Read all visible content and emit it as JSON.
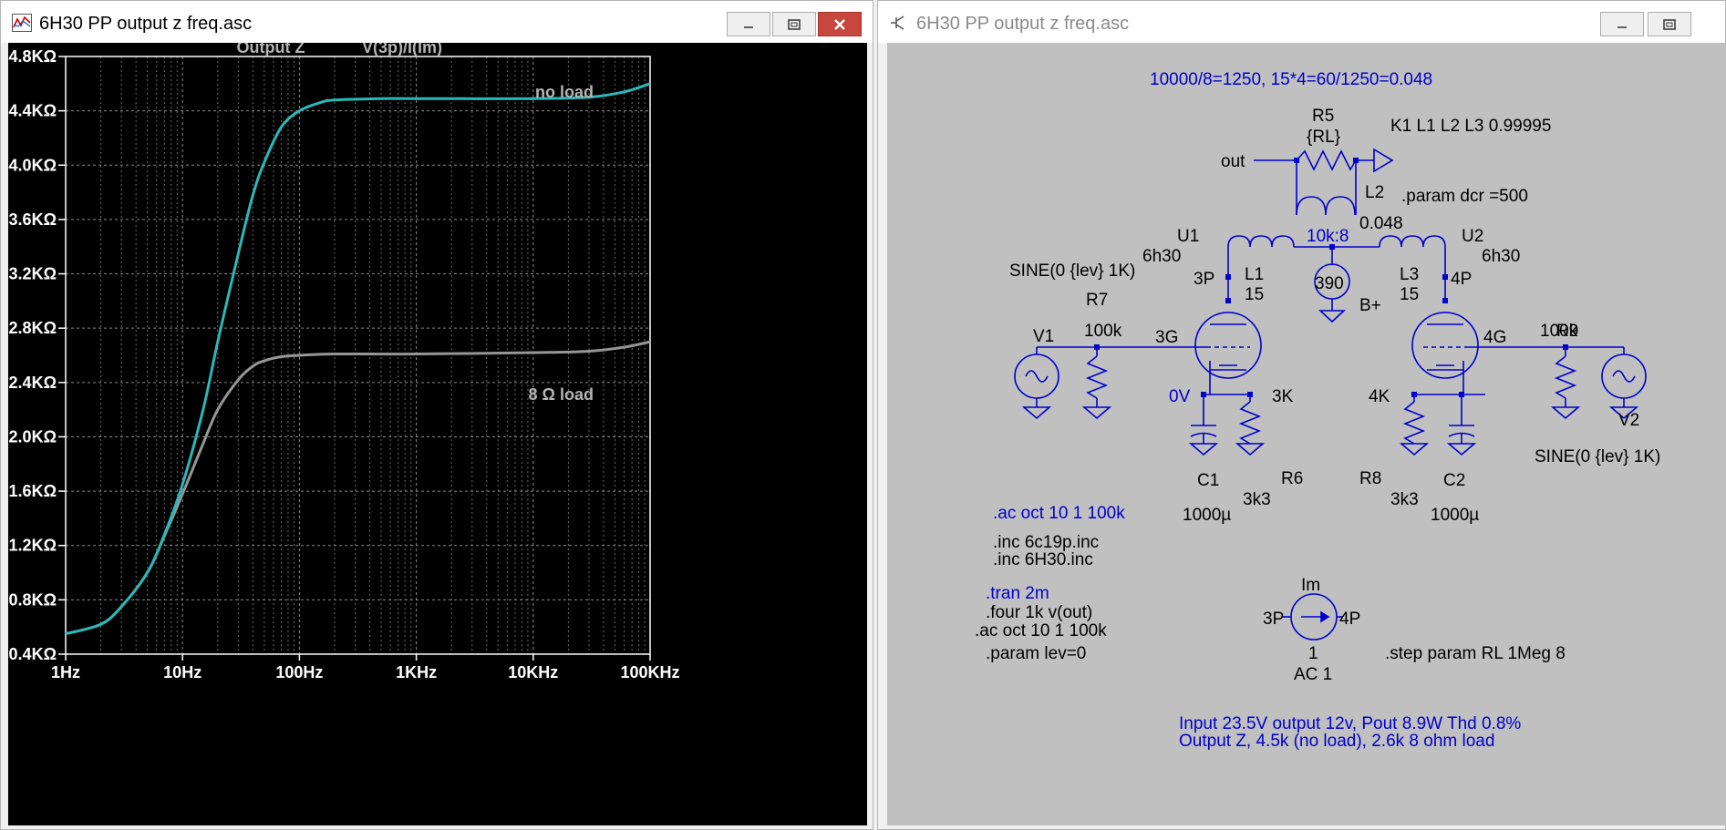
{
  "left_window": {
    "title": "6H30 PP output z freq.asc",
    "controls": [
      "minimize-icon",
      "maximize-icon",
      "close-icon"
    ]
  },
  "right_window": {
    "title": "6H30 PP output z freq.asc",
    "controls": [
      "minimize-icon",
      "maximize-icon"
    ]
  },
  "chart_data": {
    "type": "line",
    "title": "Output Z",
    "subtitle": "V(3p)/I(Im)",
    "xscale": "log",
    "xlim": [
      1,
      100000
    ],
    "ylim": [
      0.4,
      4.8
    ],
    "x_tick_values": [
      1,
      10,
      100,
      1000,
      10000,
      100000
    ],
    "x_tick_labels": [
      "1Hz",
      "10Hz",
      "100Hz",
      "1KHz",
      "10KHz",
      "100KHz"
    ],
    "y_tick_values": [
      0.4,
      0.8,
      1.2,
      1.6,
      2.0,
      2.4,
      2.8,
      3.2,
      3.6,
      4.0,
      4.4,
      4.8
    ],
    "y_tick_labels": [
      "0.4KΩ",
      "0.8KΩ",
      "1.2KΩ",
      "1.6KΩ",
      "2.0KΩ",
      "2.4KΩ",
      "2.8KΩ",
      "3.2KΩ",
      "3.6KΩ",
      "4.0KΩ",
      "4.4KΩ",
      "4.8KΩ"
    ],
    "grid": true,
    "background": "#000000",
    "series": [
      {
        "name": "no load",
        "color": "#2bb8b8",
        "points": [
          [
            1,
            0.55
          ],
          [
            2,
            0.62
          ],
          [
            3,
            0.75
          ],
          [
            5,
            1.0
          ],
          [
            7,
            1.28
          ],
          [
            10,
            1.65
          ],
          [
            15,
            2.2
          ],
          [
            20,
            2.7
          ],
          [
            30,
            3.35
          ],
          [
            40,
            3.78
          ],
          [
            50,
            4.02
          ],
          [
            70,
            4.28
          ],
          [
            100,
            4.4
          ],
          [
            150,
            4.46
          ],
          [
            200,
            4.48
          ],
          [
            500,
            4.49
          ],
          [
            1000,
            4.49
          ],
          [
            10000,
            4.49
          ],
          [
            30000,
            4.5
          ],
          [
            60000,
            4.54
          ],
          [
            100000,
            4.6
          ]
        ]
      },
      {
        "name": "8 Ω load",
        "color": "#969696",
        "points": [
          [
            1,
            0.55
          ],
          [
            2,
            0.62
          ],
          [
            3,
            0.75
          ],
          [
            5,
            1.0
          ],
          [
            7,
            1.27
          ],
          [
            10,
            1.58
          ],
          [
            15,
            1.95
          ],
          [
            20,
            2.2
          ],
          [
            30,
            2.42
          ],
          [
            40,
            2.52
          ],
          [
            50,
            2.56
          ],
          [
            70,
            2.59
          ],
          [
            100,
            2.6
          ],
          [
            200,
            2.61
          ],
          [
            1000,
            2.61
          ],
          [
            10000,
            2.62
          ],
          [
            30000,
            2.63
          ],
          [
            60000,
            2.66
          ],
          [
            100000,
            2.7
          ]
        ]
      }
    ]
  },
  "schematic": {
    "notes": {
      "ratio_note": "10000/8=1250, 15*4=60/1250=0.048",
      "coupling": "K1 L1 L2 L3 0.99995",
      "param_dcr": ".param dcr =500",
      "ac_blue": ".ac oct 10 1 100k",
      "inc1": ".inc 6c19p.inc",
      "inc2": ".inc 6H30.inc",
      "tran": ".tran 2m",
      "four": ".four 1k v(out)",
      "ac2": ".ac oct 10 1 100k",
      "param_lev": ".param lev=0",
      "step": ".step param RL 1Meg 8",
      "result1": "Input 23.5V output 12v, Pout 8.9W Thd 0.8%",
      "result2": "Output Z, 4.5k (no load), 2.6k 8 ohm load"
    },
    "labels": {
      "r5": "R5",
      "r5_val": "{RL}",
      "out": "out",
      "l2": "L2",
      "l2_val": "0.048",
      "ratio": "10k:8",
      "u1": "U1",
      "u1_model": "6h30",
      "u2": "U2",
      "u2_model": "6h30",
      "l1": "L1",
      "l1_val": "15",
      "l3": "L3",
      "l3_val": "15",
      "n3p": "3P",
      "n4p": "4P",
      "bplus_val": "390",
      "bplus": "B+",
      "sine1": "SINE(0 {lev} 1K)",
      "sine2": "SINE(0 {lev} 1K)",
      "r7": "R7",
      "r7_val": "100k",
      "r9": "R9",
      "r9_val": "100k",
      "v1": "V1",
      "v2": "V2",
      "n3g": "3G",
      "n4g": "4G",
      "n0v": "0V",
      "n3k": "3K",
      "n4k": "4K",
      "c1": "C1",
      "c1_val": "1000µ",
      "r6": "R6",
      "r6_val": "3k3",
      "r8": "R8",
      "r8_val": "3k3",
      "c2": "C2",
      "c2_val": "1000µ",
      "im": "Im",
      "im_3p": "3P",
      "im_4p": "4P",
      "im_val": "1",
      "im_ac": "AC 1"
    }
  }
}
